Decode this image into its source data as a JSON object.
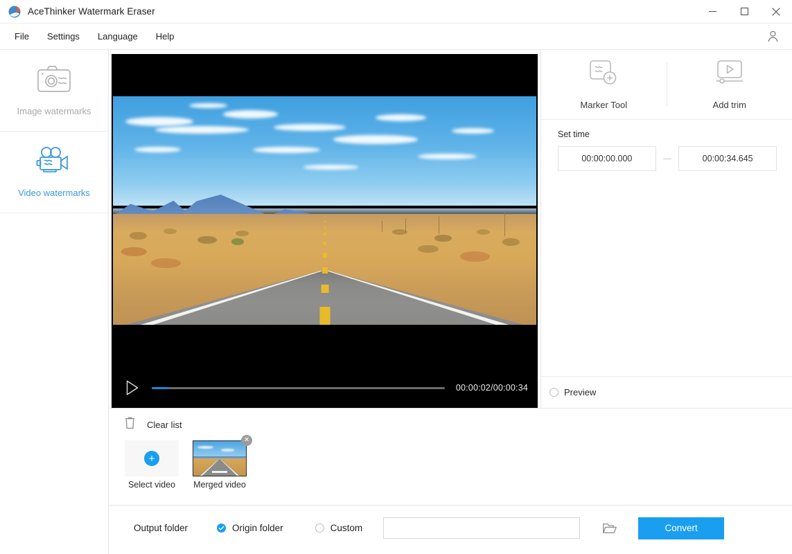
{
  "window": {
    "title": "AceThinker Watermark Eraser",
    "logo_icon": "acethinker-logo-icon",
    "minimize_icon": "minimize-icon",
    "maximize_icon": "maximize-icon",
    "close_icon": "close-icon"
  },
  "menubar": {
    "items": [
      {
        "label": "File"
      },
      {
        "label": "Settings"
      },
      {
        "label": "Language"
      },
      {
        "label": "Help"
      }
    ],
    "account_icon": "user-account-icon"
  },
  "sidebar": {
    "items": [
      {
        "label": "Image watermarks",
        "icon": "camera-watermark-icon",
        "active": false
      },
      {
        "label": "Video watermarks",
        "icon": "video-camera-watermark-icon",
        "active": true
      }
    ]
  },
  "player": {
    "play_icon": "play-icon",
    "time": "00:00:02/00:00:34",
    "progress_percent": 6
  },
  "tools": {
    "marker_tool": {
      "label": "Marker Tool",
      "icon": "marker-tool-icon"
    },
    "add_trim": {
      "label": "Add trim",
      "icon": "add-trim-icon"
    },
    "set_time": {
      "label": "Set time",
      "start": "00:00:00.000",
      "end": "00:00:34.645"
    },
    "preview": {
      "label": "Preview",
      "checked": false
    }
  },
  "filelist": {
    "clear_list_label": "Clear list",
    "trash_icon": "trash-icon",
    "select_video_label": "Select video",
    "add_icon": "plus-icon",
    "items": [
      {
        "caption": "Merged video",
        "close_icon": "close-icon",
        "thumbnail": "desert-road-thumbnail"
      }
    ]
  },
  "bottom": {
    "output_folder_label": "Output folder",
    "origin_folder_label": "Origin folder",
    "origin_folder_checked": true,
    "custom_label": "Custom",
    "custom_checked": false,
    "custom_path_value": "",
    "custom_path_placeholder": "",
    "browse_icon": "folder-open-icon",
    "convert_label": "Convert"
  },
  "colors": {
    "accent_blue": "#1a9ff0",
    "active_sidebar": "#3a9ad9",
    "inactive_gray": "#a8a8a8",
    "seek_fill": "#1a8ad5"
  }
}
